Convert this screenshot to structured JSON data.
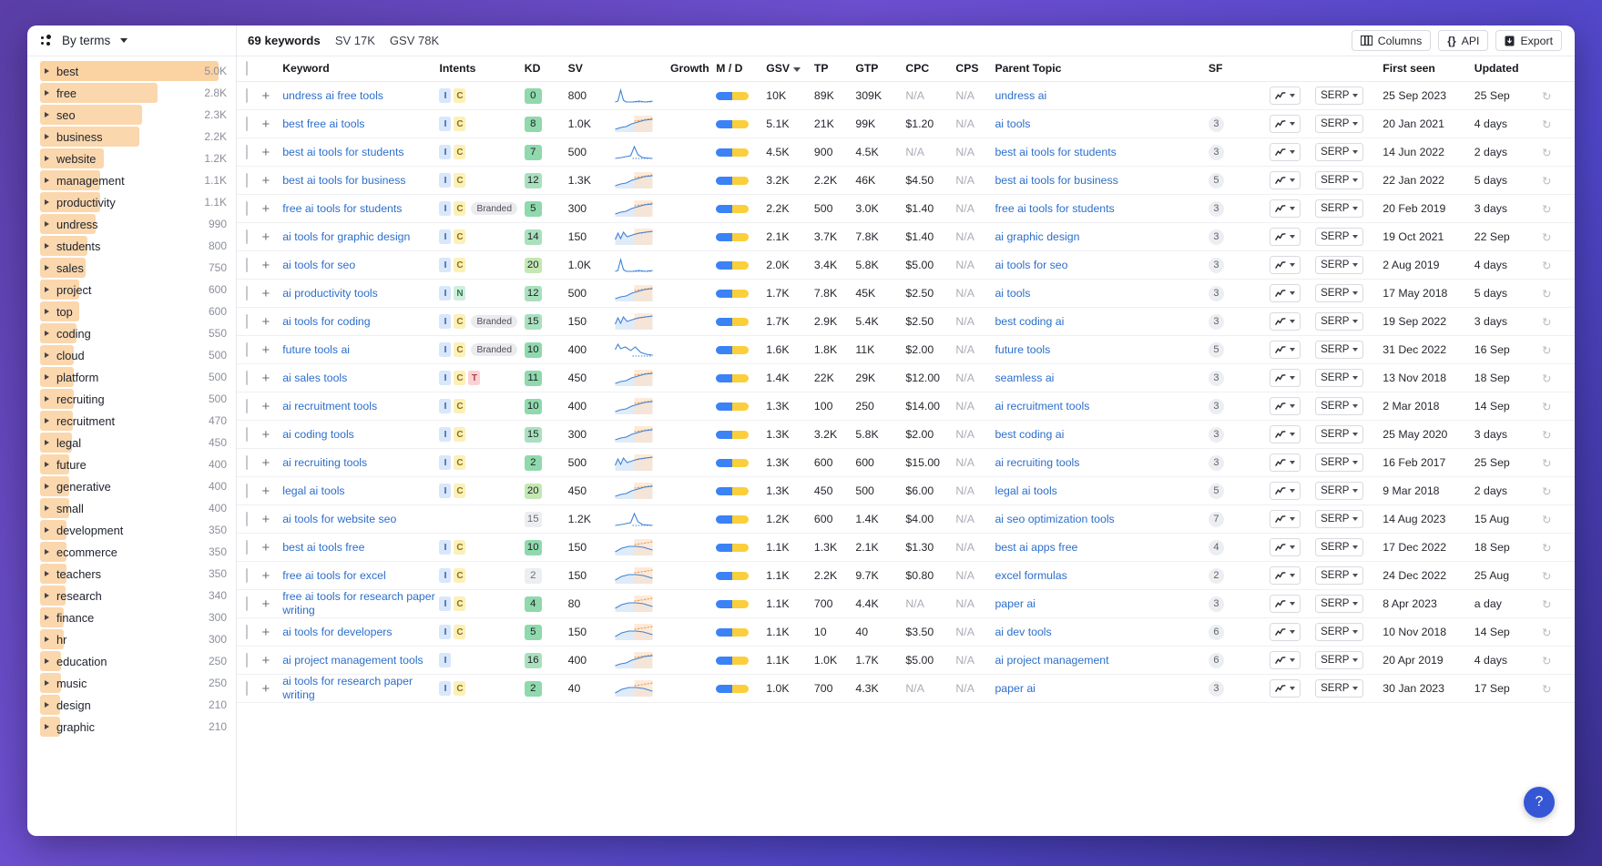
{
  "sidebar": {
    "header_label": "By terms",
    "max_value": 5000,
    "items": [
      {
        "label": "best",
        "value": "5.0K",
        "n": 5000,
        "selected": true
      },
      {
        "label": "free",
        "value": "2.8K",
        "n": 2800
      },
      {
        "label": "seo",
        "value": "2.3K",
        "n": 2300
      },
      {
        "label": "business",
        "value": "2.2K",
        "n": 2200
      },
      {
        "label": "website",
        "value": "1.2K",
        "n": 1200
      },
      {
        "label": "management",
        "value": "1.1K",
        "n": 1100
      },
      {
        "label": "productivity",
        "value": "1.1K",
        "n": 1100
      },
      {
        "label": "undress",
        "value": "990",
        "n": 990
      },
      {
        "label": "students",
        "value": "800",
        "n": 800
      },
      {
        "label": "sales",
        "value": "750",
        "n": 750
      },
      {
        "label": "project",
        "value": "600",
        "n": 600
      },
      {
        "label": "top",
        "value": "600",
        "n": 600
      },
      {
        "label": "coding",
        "value": "550",
        "n": 550
      },
      {
        "label": "cloud",
        "value": "500",
        "n": 500
      },
      {
        "label": "platform",
        "value": "500",
        "n": 500
      },
      {
        "label": "recruiting",
        "value": "500",
        "n": 500
      },
      {
        "label": "recruitment",
        "value": "470",
        "n": 470
      },
      {
        "label": "legal",
        "value": "450",
        "n": 450
      },
      {
        "label": "future",
        "value": "400",
        "n": 400
      },
      {
        "label": "generative",
        "value": "400",
        "n": 400
      },
      {
        "label": "small",
        "value": "400",
        "n": 400
      },
      {
        "label": "development",
        "value": "350",
        "n": 350
      },
      {
        "label": "ecommerce",
        "value": "350",
        "n": 350
      },
      {
        "label": "teachers",
        "value": "350",
        "n": 350
      },
      {
        "label": "research",
        "value": "340",
        "n": 340
      },
      {
        "label": "finance",
        "value": "300",
        "n": 300
      },
      {
        "label": "hr",
        "value": "300",
        "n": 300
      },
      {
        "label": "education",
        "value": "250",
        "n": 250
      },
      {
        "label": "music",
        "value": "250",
        "n": 250
      },
      {
        "label": "design",
        "value": "210",
        "n": 210
      },
      {
        "label": "graphic",
        "value": "210",
        "n": 210
      }
    ]
  },
  "toolbar": {
    "keywords_count": "69 keywords",
    "sv_total": "SV 17K",
    "gsv_total": "GSV 78K",
    "columns_label": "Columns",
    "api_label": "API",
    "export_label": "Export"
  },
  "table": {
    "columns": [
      "Keyword",
      "Intents",
      "KD",
      "SV",
      "Growth",
      "M / D",
      "GSV",
      "TP",
      "GTP",
      "CPC",
      "CPS",
      "Parent Topic",
      "SF",
      "First seen",
      "Updated"
    ],
    "sorted_column": "GSV",
    "rows": [
      {
        "keyword": "undress ai free tools",
        "intents": [
          "I",
          "C"
        ],
        "branded": false,
        "kd": "0",
        "kd_tone": "g1",
        "sv": "800",
        "spark": "spike-left",
        "growth": "100%",
        "md": [
          50,
          50
        ],
        "gsv": "10K",
        "tp": "89K",
        "gtp": "309K",
        "cpc": "N/A",
        "cps": "N/A",
        "parent": "undress ai",
        "sf": "",
        "serp": "SERP",
        "first_seen": "25 Sep 2023",
        "updated": "25 Sep"
      },
      {
        "keyword": "best free ai tools",
        "intents": [
          "I",
          "C"
        ],
        "branded": false,
        "kd": "8",
        "kd_tone": "g1",
        "sv": "1.0K",
        "spark": "rise",
        "growth": "100%",
        "md": [
          50,
          50
        ],
        "gsv": "5.1K",
        "tp": "21K",
        "gtp": "99K",
        "cpc": "$1.20",
        "cps": "N/A",
        "parent": "ai tools",
        "sf": "3",
        "serp": "SERP",
        "first_seen": "20 Jan 2021",
        "updated": "4 days"
      },
      {
        "keyword": "best ai tools for students",
        "intents": [
          "I",
          "C"
        ],
        "branded": false,
        "kd": "7",
        "kd_tone": "g1",
        "sv": "500",
        "spark": "spike-mid",
        "growth": "100%",
        "md": [
          50,
          50
        ],
        "gsv": "4.5K",
        "tp": "900",
        "gtp": "4.5K",
        "cpc": "N/A",
        "cps": "N/A",
        "parent": "best ai tools for students",
        "sf": "3",
        "serp": "SERP",
        "first_seen": "14 Jun 2022",
        "updated": "2 days"
      },
      {
        "keyword": "best ai tools for business",
        "intents": [
          "I",
          "C"
        ],
        "branded": false,
        "kd": "12",
        "kd_tone": "g2",
        "sv": "1.3K",
        "spark": "rise",
        "growth": "100%",
        "md": [
          50,
          50
        ],
        "gsv": "3.2K",
        "tp": "2.2K",
        "gtp": "46K",
        "cpc": "$4.50",
        "cps": "N/A",
        "parent": "best ai tools for business",
        "sf": "5",
        "serp": "SERP",
        "first_seen": "22 Jan 2022",
        "updated": "5 days"
      },
      {
        "keyword": "free ai tools for students",
        "intents": [
          "I",
          "C"
        ],
        "branded": true,
        "kd": "5",
        "kd_tone": "g1",
        "sv": "300",
        "spark": "rise",
        "growth": "100%",
        "md": [
          50,
          50
        ],
        "gsv": "2.2K",
        "tp": "500",
        "gtp": "3.0K",
        "cpc": "$1.40",
        "cps": "N/A",
        "parent": "free ai tools for students",
        "sf": "3",
        "serp": "SERP",
        "first_seen": "20 Feb 2019",
        "updated": "3 days"
      },
      {
        "keyword": "ai tools for graphic design",
        "intents": [
          "I",
          "C"
        ],
        "branded": false,
        "kd": "14",
        "kd_tone": "g2",
        "sv": "150",
        "spark": "wave",
        "growth": "100%",
        "md": [
          50,
          50
        ],
        "gsv": "2.1K",
        "tp": "3.7K",
        "gtp": "7.8K",
        "cpc": "$1.40",
        "cps": "N/A",
        "parent": "ai graphic design",
        "sf": "3",
        "serp": "SERP",
        "first_seen": "19 Oct 2021",
        "updated": "22 Sep"
      },
      {
        "keyword": "ai tools for seo",
        "intents": [
          "I",
          "C"
        ],
        "branded": false,
        "kd": "20",
        "kd_tone": "g3",
        "sv": "1.0K",
        "spark": "spike-left",
        "growth": "100%",
        "md": [
          50,
          50
        ],
        "gsv": "2.0K",
        "tp": "3.4K",
        "gtp": "5.8K",
        "cpc": "$5.00",
        "cps": "N/A",
        "parent": "ai tools for seo",
        "sf": "3",
        "serp": "SERP",
        "first_seen": "2 Aug 2019",
        "updated": "4 days"
      },
      {
        "keyword": "ai productivity tools",
        "intents": [
          "I",
          "N"
        ],
        "branded": false,
        "kd": "12",
        "kd_tone": "g2",
        "sv": "500",
        "spark": "rise",
        "growth": "100%",
        "md": [
          50,
          50
        ],
        "gsv": "1.7K",
        "tp": "7.8K",
        "gtp": "45K",
        "cpc": "$2.50",
        "cps": "N/A",
        "parent": "ai tools",
        "sf": "3",
        "serp": "SERP",
        "first_seen": "17 May 2018",
        "updated": "5 days"
      },
      {
        "keyword": "ai tools for coding",
        "intents": [
          "I",
          "C"
        ],
        "branded": true,
        "kd": "15",
        "kd_tone": "g2",
        "sv": "150",
        "spark": "wave",
        "growth": "100%",
        "md": [
          50,
          50
        ],
        "gsv": "1.7K",
        "tp": "2.9K",
        "gtp": "5.4K",
        "cpc": "$2.50",
        "cps": "N/A",
        "parent": "best coding ai",
        "sf": "3",
        "serp": "SERP",
        "first_seen": "19 Sep 2022",
        "updated": "3 days"
      },
      {
        "keyword": "future tools ai",
        "intents": [
          "I",
          "C"
        ],
        "branded": true,
        "kd": "10",
        "kd_tone": "g1",
        "sv": "400",
        "spark": "decline",
        "growth": "100%",
        "md": [
          50,
          50
        ],
        "gsv": "1.6K",
        "tp": "1.8K",
        "gtp": "11K",
        "cpc": "$2.00",
        "cps": "N/A",
        "parent": "future tools",
        "sf": "5",
        "serp": "SERP",
        "first_seen": "31 Dec 2022",
        "updated": "16 Sep"
      },
      {
        "keyword": "ai sales tools",
        "intents": [
          "I",
          "C",
          "T"
        ],
        "branded": false,
        "kd": "11",
        "kd_tone": "g1",
        "sv": "450",
        "spark": "rise",
        "growth": "100%",
        "md": [
          50,
          50
        ],
        "gsv": "1.4K",
        "tp": "22K",
        "gtp": "29K",
        "cpc": "$12.00",
        "cps": "N/A",
        "parent": "seamless ai",
        "sf": "3",
        "serp": "SERP",
        "first_seen": "13 Nov 2018",
        "updated": "18 Sep"
      },
      {
        "keyword": "ai recruitment tools",
        "intents": [
          "I",
          "C"
        ],
        "branded": false,
        "kd": "10",
        "kd_tone": "g1",
        "sv": "400",
        "spark": "rise",
        "growth": "100%",
        "md": [
          50,
          50
        ],
        "gsv": "1.3K",
        "tp": "100",
        "gtp": "250",
        "cpc": "$14.00",
        "cps": "N/A",
        "parent": "ai recruitment tools",
        "sf": "3",
        "serp": "SERP",
        "first_seen": "2 Mar 2018",
        "updated": "14 Sep"
      },
      {
        "keyword": "ai coding tools",
        "intents": [
          "I",
          "C"
        ],
        "branded": false,
        "kd": "15",
        "kd_tone": "g2",
        "sv": "300",
        "spark": "rise",
        "growth": "100%",
        "md": [
          50,
          50
        ],
        "gsv": "1.3K",
        "tp": "3.2K",
        "gtp": "5.8K",
        "cpc": "$2.00",
        "cps": "N/A",
        "parent": "best coding ai",
        "sf": "3",
        "serp": "SERP",
        "first_seen": "25 May 2020",
        "updated": "3 days"
      },
      {
        "keyword": "ai recruiting tools",
        "intents": [
          "I",
          "C"
        ],
        "branded": false,
        "kd": "2",
        "kd_tone": "g1",
        "sv": "500",
        "spark": "wave",
        "growth": "100%",
        "md": [
          50,
          50
        ],
        "gsv": "1.3K",
        "tp": "600",
        "gtp": "600",
        "cpc": "$15.00",
        "cps": "N/A",
        "parent": "ai recruiting tools",
        "sf": "3",
        "serp": "SERP",
        "first_seen": "16 Feb 2017",
        "updated": "25 Sep"
      },
      {
        "keyword": "legal ai tools",
        "intents": [
          "I",
          "C"
        ],
        "branded": false,
        "kd": "20",
        "kd_tone": "g3",
        "sv": "450",
        "spark": "rise",
        "growth": "100%",
        "md": [
          50,
          50
        ],
        "gsv": "1.3K",
        "tp": "450",
        "gtp": "500",
        "cpc": "$6.00",
        "cps": "N/A",
        "parent": "legal ai tools",
        "sf": "5",
        "serp": "SERP",
        "first_seen": "9 Mar 2018",
        "updated": "2 days"
      },
      {
        "keyword": "ai tools for website seo",
        "intents": [],
        "branded": false,
        "kd": "15",
        "kd_tone": "gray",
        "sv": "1.2K",
        "spark": "spike-mid",
        "growth": "100%",
        "md": [
          50,
          50
        ],
        "gsv": "1.2K",
        "tp": "600",
        "gtp": "1.4K",
        "cpc": "$4.00",
        "cps": "N/A",
        "parent": "ai seo optimization tools",
        "sf": "7",
        "serp": "SERP",
        "first_seen": "14 Aug 2023",
        "updated": "15 Aug"
      },
      {
        "keyword": "best ai tools free",
        "intents": [
          "I",
          "C"
        ],
        "branded": false,
        "kd": "10",
        "kd_tone": "g1",
        "sv": "150",
        "spark": "flat",
        "growth": "100%",
        "md": [
          50,
          50
        ],
        "gsv": "1.1K",
        "tp": "1.3K",
        "gtp": "2.1K",
        "cpc": "$1.30",
        "cps": "N/A",
        "parent": "best ai apps free",
        "sf": "4",
        "serp": "SERP",
        "first_seen": "17 Dec 2022",
        "updated": "18 Sep"
      },
      {
        "keyword": "free ai tools for excel",
        "intents": [
          "I",
          "C"
        ],
        "branded": false,
        "kd": "2",
        "kd_tone": "gray",
        "sv": "150",
        "spark": "flat",
        "growth": "100%",
        "md": [
          50,
          50
        ],
        "gsv": "1.1K",
        "tp": "2.2K",
        "gtp": "9.7K",
        "cpc": "$0.80",
        "cps": "N/A",
        "parent": "excel formulas",
        "sf": "2",
        "serp": "SERP",
        "first_seen": "24 Dec 2022",
        "updated": "25 Aug"
      },
      {
        "keyword": "free ai tools for research paper writing",
        "intents": [
          "I",
          "C"
        ],
        "branded": false,
        "kd": "4",
        "kd_tone": "g1",
        "sv": "80",
        "spark": "flat",
        "growth": "100%",
        "md": [
          50,
          50
        ],
        "gsv": "1.1K",
        "tp": "700",
        "gtp": "4.4K",
        "cpc": "N/A",
        "cps": "N/A",
        "parent": "paper ai",
        "sf": "3",
        "serp": "SERP",
        "first_seen": "8 Apr 2023",
        "updated": "a day"
      },
      {
        "keyword": "ai tools for developers",
        "intents": [
          "I",
          "C"
        ],
        "branded": false,
        "kd": "5",
        "kd_tone": "g1",
        "sv": "150",
        "spark": "flat",
        "growth": "100%",
        "md": [
          50,
          50
        ],
        "gsv": "1.1K",
        "tp": "10",
        "gtp": "40",
        "cpc": "$3.50",
        "cps": "N/A",
        "parent": "ai dev tools",
        "sf": "6",
        "serp": "SERP",
        "first_seen": "10 Nov 2018",
        "updated": "14 Sep"
      },
      {
        "keyword": "ai project management tools",
        "intents": [
          "I"
        ],
        "branded": false,
        "kd": "16",
        "kd_tone": "g2",
        "sv": "400",
        "spark": "rise",
        "growth": "100%",
        "md": [
          50,
          50
        ],
        "gsv": "1.1K",
        "tp": "1.0K",
        "gtp": "1.7K",
        "cpc": "$5.00",
        "cps": "N/A",
        "parent": "ai project management",
        "sf": "6",
        "serp": "SERP",
        "first_seen": "20 Apr 2019",
        "updated": "4 days"
      },
      {
        "keyword": "ai tools for research paper writing",
        "intents": [
          "I",
          "C"
        ],
        "branded": false,
        "kd": "2",
        "kd_tone": "g1",
        "sv": "40",
        "spark": "flat",
        "growth": "100%",
        "md": [
          50,
          50
        ],
        "gsv": "1.0K",
        "tp": "700",
        "gtp": "4.3K",
        "cpc": "N/A",
        "cps": "N/A",
        "parent": "paper ai",
        "sf": "3",
        "serp": "SERP",
        "first_seen": "30 Jan 2023",
        "updated": "17 Sep"
      }
    ]
  },
  "help": {
    "label": "?"
  },
  "colors": {
    "accent": "#2c6ecb",
    "bar": "#fbd7ad",
    "help_bg": "#3557d6"
  }
}
